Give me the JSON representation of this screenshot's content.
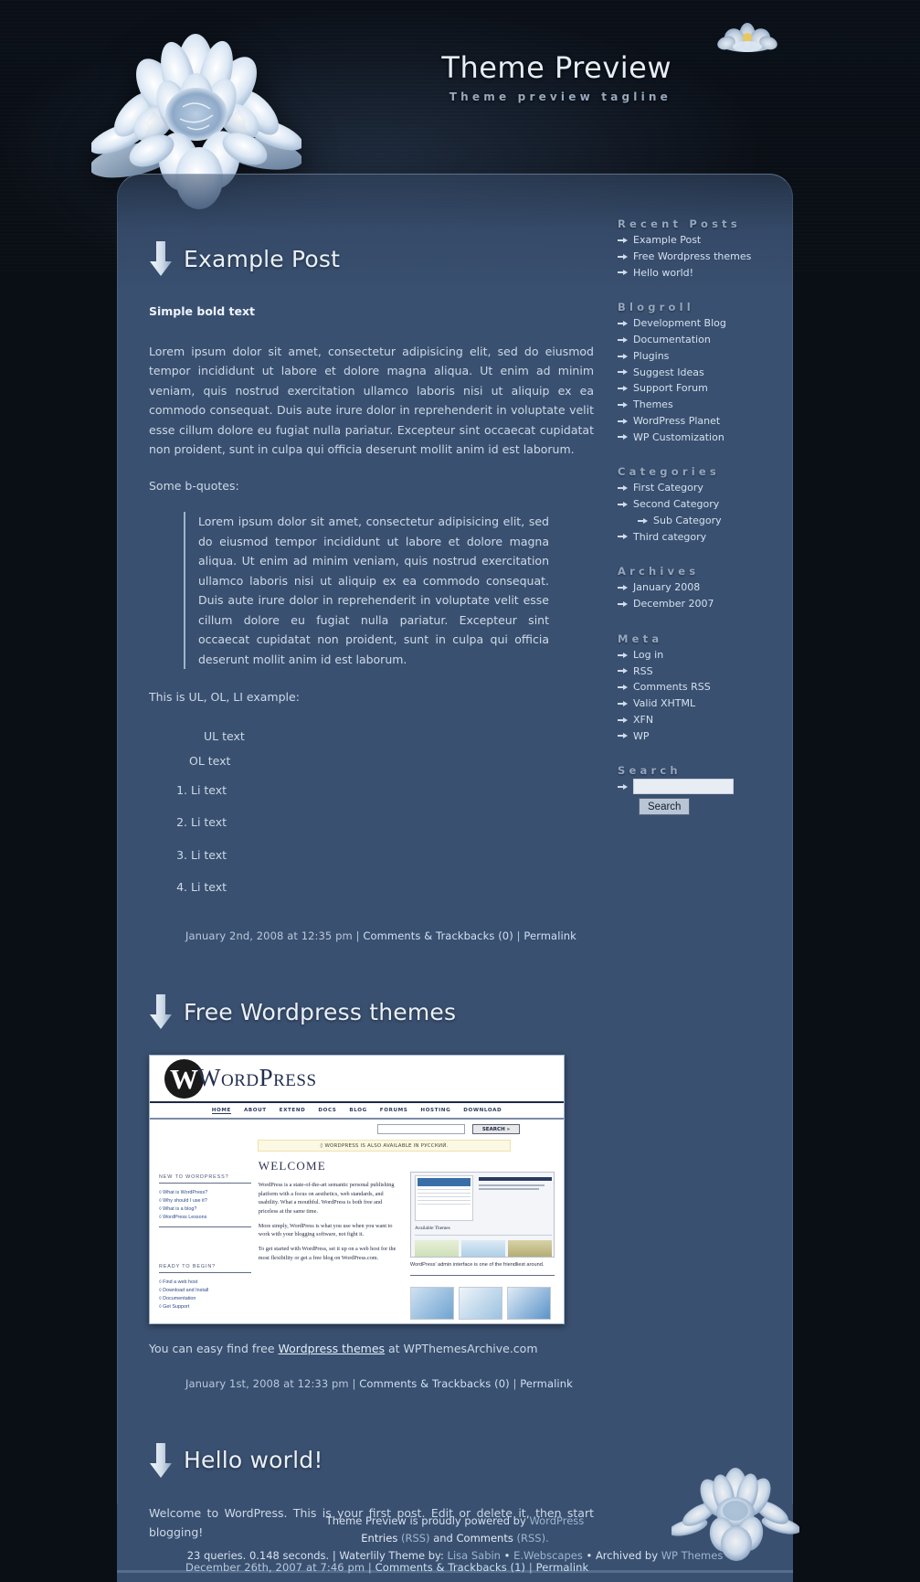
{
  "header": {
    "title": "Theme Preview",
    "tagline": "Theme preview tagline"
  },
  "colors": {
    "panel": "#3a5070",
    "background": "#0a0e15",
    "heading": "#93a7bf",
    "link": "#d4e0ee"
  },
  "posts": [
    {
      "title": "Example Post",
      "bold_line": "Simple bold text",
      "paragraph1": "Lorem ipsum dolor sit amet, consectetur adipisicing elit, sed do eiusmod tempor incididunt ut labore et dolore magna aliqua. Ut enim ad minim veniam, quis nostrud exercitation ullamco laboris nisi ut aliquip ex ea commodo consequat. Duis aute irure dolor in reprehenderit in voluptate velit esse cillum dolore eu fugiat nulla pariatur. Excepteur sint occaecat cupidatat non proident, sunt in culpa qui officia deserunt mollit anim id est laborum.",
      "quote_intro": "Some b-quotes:",
      "blockquote": "Lorem ipsum dolor sit amet, consectetur adipisicing elit, sed do eiusmod tempor incididunt ut labore et dolore magna aliqua. Ut enim ad minim veniam, quis nostrud exercitation ullamco laboris nisi ut aliquip ex ea commodo consequat. Duis aute irure dolor in reprehenderit in voluptate velit esse cillum dolore eu fugiat nulla pariatur. Excepteur sint occaecat cupidatat non proident, sunt in culpa qui officia deserunt mollit anim id est laborum.",
      "list_intro": "This is UL, OL, LI example:",
      "ul_text": "UL text",
      "ol_text": "OL text",
      "li_items": [
        "Li text",
        "Li text",
        "Li text",
        "Li text"
      ],
      "meta_date": "January 2nd, 2008 at 12:35 pm",
      "meta_sep1": "|",
      "meta_comments": "Comments & Trackbacks (0)",
      "meta_sep2": "|",
      "meta_permalink": "Permalink"
    },
    {
      "title": "Free Wordpress themes",
      "caption_pre": "You can easy find free ",
      "caption_link": "Wordpress themes",
      "caption_post": " at WPThemesArchive.com",
      "meta_date": "January 1st, 2008 at 12:33 pm",
      "meta_sep1": "|",
      "meta_comments": "Comments & Trackbacks (0)",
      "meta_sep2": "|",
      "meta_permalink": "Permalink"
    },
    {
      "title": "Hello world!",
      "paragraph1": "Welcome to WordPress. This is your first post. Edit or delete it, then start blogging!",
      "meta_date": "December 26th, 2007 at 7:46 pm",
      "meta_sep1": "|",
      "meta_comments": "Comments & Trackbacks (1)",
      "meta_sep2": "|",
      "meta_permalink": "Permalink"
    }
  ],
  "embedded_screenshot": {
    "logo_mark": "W",
    "logo_text": "WordPress",
    "nav": [
      "HOME",
      "ABOUT",
      "EXTEND",
      "DOCS",
      "BLOG",
      "FORUMS",
      "HOSTING",
      "DOWNLOAD"
    ],
    "search_button": "SEARCH »",
    "notice": "◊ WORDPRESS IS ALSO AVAILABLE IN РУССКИЙ.",
    "welcome_heading": "WELCOME",
    "col1_head1": "NEW TO WORDPRESS?",
    "col1_links1": [
      "What is WordPress?",
      "Why should I use it?",
      "What is a blog?",
      "WordPress Lessons"
    ],
    "col1_head2": "READY TO BEGIN?",
    "col1_links2": [
      "Find a web host",
      "Download and Install",
      "Documentation",
      "Get Support"
    ],
    "para1": "WordPress is a state-of-the-art semantic personal publishing platform with a focus on aesthetics, web standards, and usability. What a mouthful. WordPress is both free and priceless at the same time.",
    "para2": "More simply, WordPress is what you use when you want to work with your blogging software, not fight it.",
    "para3": "To get started with WordPress, set it up on a web host for the most flexibility or get a free blog on WordPress.com.",
    "available_themes": "Available Themes",
    "admin_caption": "WordPress' admin interface is one of the friendliest around."
  },
  "sidebar": {
    "sections": [
      {
        "title": "Recent Posts",
        "items": [
          {
            "label": "Example Post"
          },
          {
            "label": "Free Wordpress themes"
          },
          {
            "label": "Hello world!"
          }
        ]
      },
      {
        "title": "Blogroll",
        "items": [
          {
            "label": "Development Blog"
          },
          {
            "label": "Documentation"
          },
          {
            "label": "Plugins"
          },
          {
            "label": "Suggest Ideas"
          },
          {
            "label": "Support Forum"
          },
          {
            "label": "Themes"
          },
          {
            "label": "WordPress Planet"
          },
          {
            "label": "WP Customization"
          }
        ]
      },
      {
        "title": "Categories",
        "items": [
          {
            "label": "First Category"
          },
          {
            "label": "Second Category"
          },
          {
            "label": "Sub Category",
            "indent": true
          },
          {
            "label": "Third category"
          }
        ]
      },
      {
        "title": "Archives",
        "items": [
          {
            "label": "January 2008"
          },
          {
            "label": "December 2007"
          }
        ]
      },
      {
        "title": "Meta",
        "items": [
          {
            "label": "Log in"
          },
          {
            "label": "RSS"
          },
          {
            "label": "Comments RSS"
          },
          {
            "label": "Valid XHTML"
          },
          {
            "label": "XFN"
          },
          {
            "label": "WP"
          }
        ]
      }
    ],
    "search": {
      "title": "Search",
      "value": "",
      "placeholder": "",
      "button_label": "Search"
    }
  },
  "footer": {
    "line1_pre": "Theme Preview is proudly powered by ",
    "line1_link": "WordPress",
    "line2_a": "Entries",
    "line2_a_paren": "(RSS)",
    "line2_and": " and ",
    "line2_b": "Comments",
    "line2_b_paren": "(RSS).",
    "line3_queries": "23 queries. 0.148 seconds.",
    "line3_sep": "|",
    "line3_theme": "Waterlily Theme by:",
    "line3_author": "Lisa Sabin",
    "line3_bullet1": "•",
    "line3_site": "E.Webscapes",
    "line3_bullet2": "•",
    "line3_archived": "Archived by",
    "line3_archiver": "WP Themes"
  }
}
